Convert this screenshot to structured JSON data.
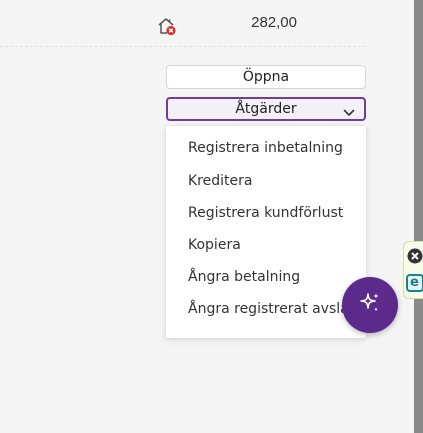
{
  "row": {
    "amount": "282,00",
    "icon": "house-cancel-icon"
  },
  "buttons": {
    "open_label": "Öppna",
    "actions_label": "Åtgärder"
  },
  "actions_menu": {
    "items": [
      {
        "label": "Registrera inbetalning"
      },
      {
        "label": "Kreditera"
      },
      {
        "label": "Registrera kundförlust"
      },
      {
        "label": "Kopiera"
      },
      {
        "label": "Ångra betalning"
      },
      {
        "label": "Ångra registrerat avslag"
      }
    ]
  },
  "assistant": {
    "icon": "sparkle-icon"
  },
  "extension": {
    "close_icon": "close-icon",
    "logo_letter": "e"
  },
  "colors": {
    "accent": "#5b2a8a",
    "accent_border": "#6b3fa0",
    "status_red": "#d9322b",
    "extension_teal": "#1a7f8e"
  }
}
